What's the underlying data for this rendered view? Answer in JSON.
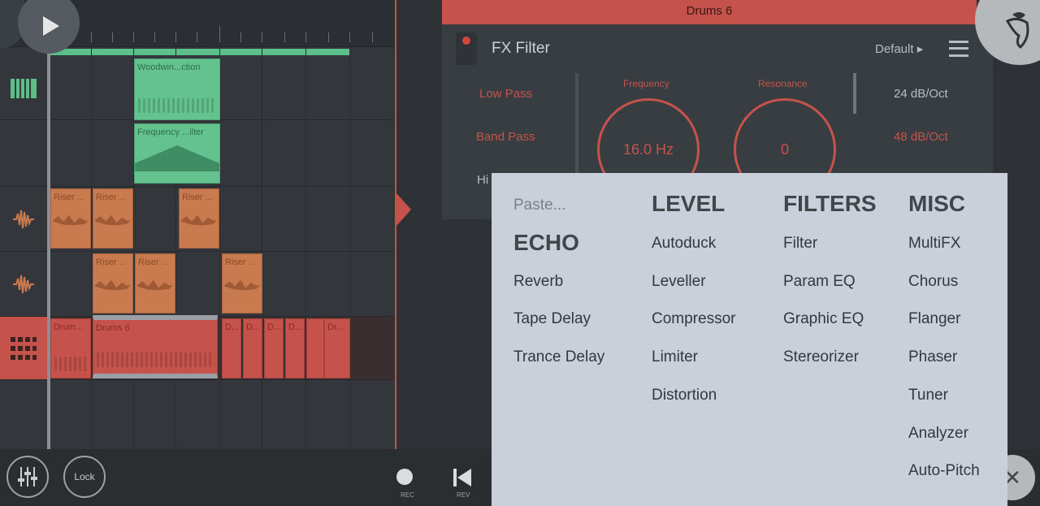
{
  "playlist": {
    "tracks": [
      {
        "icon": "piano-icon"
      },
      {
        "icon": "automation-icon"
      },
      {
        "icon": "audio-wave-icon"
      },
      {
        "icon": "audio-wave-icon"
      },
      {
        "icon": "drum-pad-icon"
      }
    ],
    "clips": {
      "woodwind": "Woodwin...ction",
      "frequency": "Frequency ...ilter",
      "riser": "Riser ...",
      "drum_short": "Drum...",
      "drums6": "Drums 6",
      "d": "D...",
      "dr": "Dr..."
    }
  },
  "bottom_bar": {
    "lock_label": "Lock",
    "rec_label": "REC",
    "rev_label": "REV"
  },
  "fx": {
    "channel_title": "Drums 6",
    "plugin_name": "FX Filter",
    "preset": "Default",
    "filter_types": [
      "Low Pass",
      "Band Pass",
      "Hi"
    ],
    "frequency_label": "Frequency",
    "frequency_value": "16.0 Hz",
    "resonance_label": "Resonance",
    "resonance_value": "0",
    "slopes": [
      "24 dB/Oct",
      "48 dB/Oct"
    ]
  },
  "menu": {
    "col1": {
      "paste": "Paste...",
      "head": "ECHO",
      "items": [
        "Reverb",
        "Tape Delay",
        "Trance Delay"
      ]
    },
    "col2": {
      "head": "LEVEL",
      "items": [
        "Autoduck",
        "Leveller",
        "Compressor",
        "Limiter",
        "Distortion"
      ]
    },
    "col3": {
      "head": "FILTERS",
      "items": [
        "Filter",
        "Param EQ",
        "Graphic EQ",
        "Stereorizer"
      ]
    },
    "col4": {
      "head": "MISC",
      "items": [
        "MultiFX",
        "Chorus",
        "Flanger",
        "Phaser",
        "Tuner",
        "Analyzer",
        "Auto-Pitch"
      ]
    }
  }
}
